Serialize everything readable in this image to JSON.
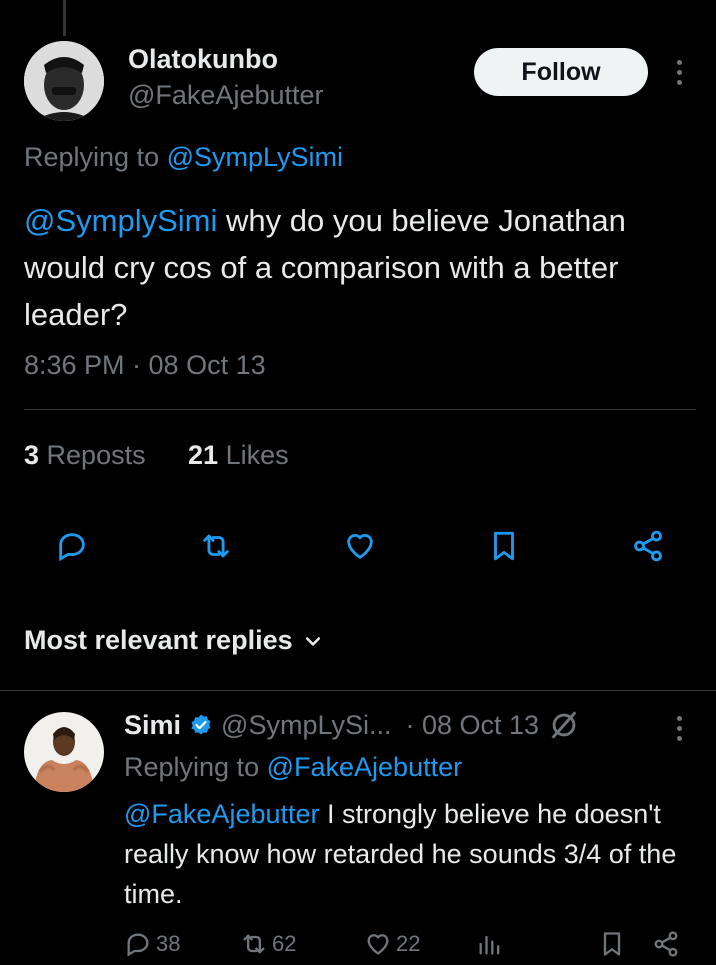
{
  "tweet": {
    "author_name": "Olatokunbo",
    "author_handle": "@FakeAjebutter",
    "follow_label": "Follow",
    "replying_prefix": "Replying to ",
    "replying_to": "@SympLySimi",
    "mention": "@SymplySimi",
    "text": " why do you believe Jonathan would cry cos of a comparison with a better leader?",
    "timestamp": "8:36 PM · 08 Oct 13",
    "reposts_count": "3",
    "reposts_label": "Reposts",
    "likes_count": "21",
    "likes_label": "Likes"
  },
  "replies_section": {
    "label": "Most relevant replies"
  },
  "reply": {
    "author_name": "Simi",
    "author_handle": "@SympLySi...",
    "date": "· 08 Oct 13",
    "replying_prefix": "Replying to ",
    "replying_to": "@FakeAjebutter",
    "mention": "@FakeAjebutter",
    "text": " I strongly believe he doesn't really know how retarded he sounds 3/4 of the time.",
    "replies_count": "38",
    "reposts_count": "62",
    "likes_count": "22"
  },
  "colors": {
    "background": "#000000",
    "link": "#1d9bf0",
    "muted": "#71767b",
    "verified": "#1d9bf0"
  }
}
